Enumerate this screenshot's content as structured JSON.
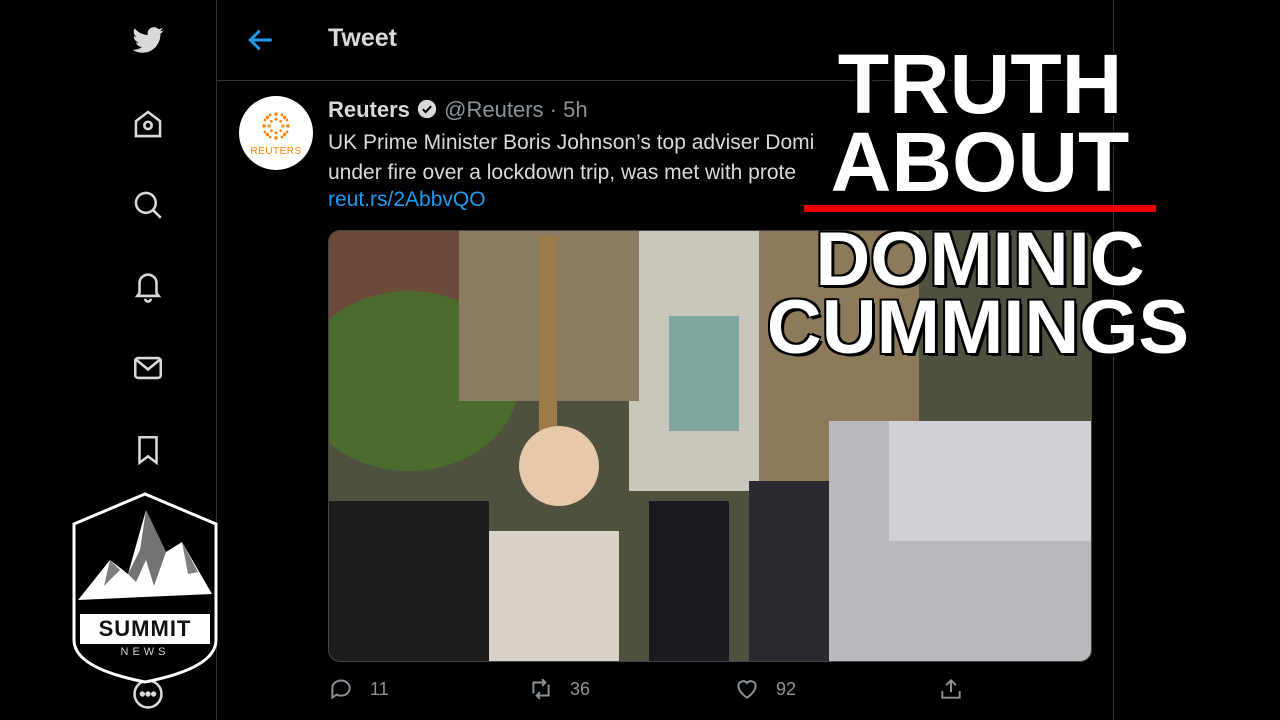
{
  "header": {
    "title": "Tweet"
  },
  "tweet": {
    "author_name": "Reuters",
    "author_meta": "@Reuters · 5h",
    "avatar_label": "REUTERS",
    "line1": "UK Prime Minister Boris Johnson’s top adviser Domi",
    "line2": "under fire over a lockdown trip, was met with prote",
    "link": "reut.rs/2AbbvQO"
  },
  "actions": {
    "replies": "11",
    "retweets": "36",
    "likes": "92"
  },
  "overlay": {
    "line1": "TRUTH",
    "line2": "ABOUT",
    "line3": "DOMINIC",
    "line4": "CUMMINGS",
    "accent": "#e00000"
  },
  "logo": {
    "name": "SUMMIT",
    "sub": "NEWS"
  },
  "nav_icons": [
    "twitter-logo-icon",
    "home-icon",
    "search-icon",
    "bell-icon",
    "mail-icon",
    "bookmark-icon",
    "more-icon"
  ],
  "colors": {
    "link": "#1d9bf0",
    "background": "#000000",
    "text": "#d9d9d9"
  }
}
